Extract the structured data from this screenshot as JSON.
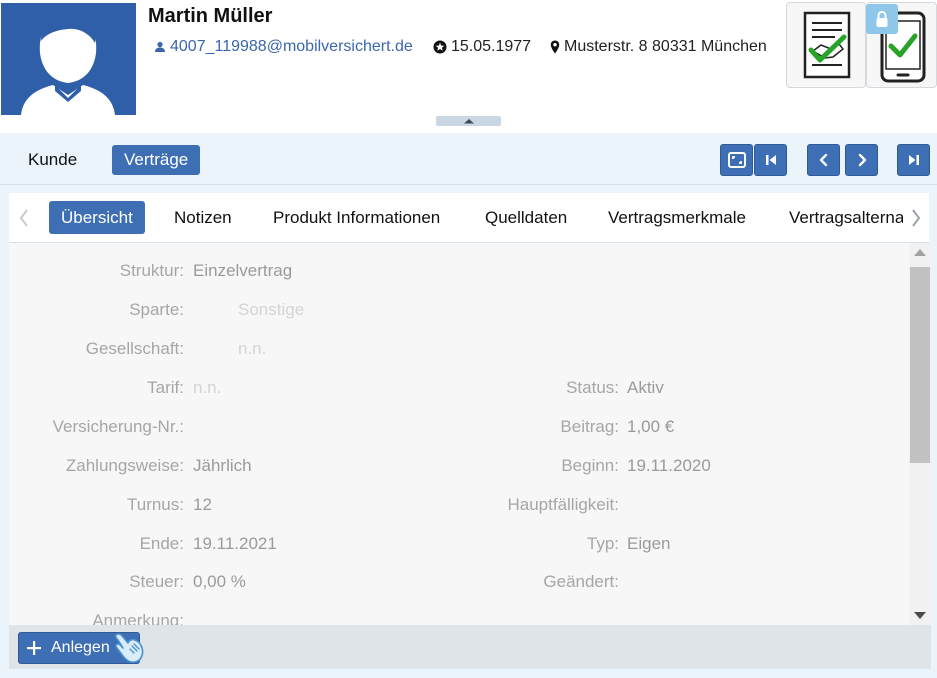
{
  "customer": {
    "name": "Martin Müller",
    "email": "4007_119988@mobilversichert.de",
    "birthdate": "15.05.1977",
    "address": "Musterstr. 8 80331 München"
  },
  "toolbar": {
    "tab_kunde": "Kunde",
    "tab_vertraege": "Verträge"
  },
  "subtabs": [
    {
      "label": "Übersicht",
      "active": true
    },
    {
      "label": "Notizen",
      "active": false
    },
    {
      "label": "Produkt Informationen",
      "active": false
    },
    {
      "label": "Quelldaten",
      "active": false
    },
    {
      "label": "Vertragsmerkmale",
      "active": false
    },
    {
      "label": "Vertragsalterna",
      "active": false
    }
  ],
  "details": {
    "struktur_label": "Struktur:",
    "struktur_value": "Einzelvertrag",
    "sparte_label": "Sparte:",
    "sparte_value": "Sonstige",
    "gesellschaft_label": "Gesellschaft:",
    "gesellschaft_value": "n.n.",
    "tarif_label": "Tarif:",
    "tarif_value": "n.n.",
    "status_label": "Status:",
    "status_value": "Aktiv",
    "versicherung_label": "Versicherung-Nr.:",
    "versicherung_value": "",
    "beitrag_label": "Beitrag:",
    "beitrag_value": "1,00 €",
    "zahlungsweise_label": "Zahlungsweise:",
    "zahlungsweise_value": "Jährlich",
    "beginn_label": "Beginn:",
    "beginn_value": "19.11.2020",
    "turnus_label": "Turnus:",
    "turnus_value": "12",
    "hauptfaelligkeit_label": "Hauptfälligkeit:",
    "hauptfaelligkeit_value": "",
    "ende_label": "Ende:",
    "ende_value": "19.11.2021",
    "typ_label": "Typ:",
    "typ_value": "Eigen",
    "steuer_label": "Steuer:",
    "steuer_value": "0,00 %",
    "geaendert_label": "Geändert:",
    "geaendert_value": "",
    "anmerkung_label": "Anmerkung:"
  },
  "footer": {
    "add_label": "Anlegen"
  },
  "colors": {
    "primary": "#3e6fb5",
    "avatar_bg": "#2f5fa8",
    "panel_bg": "#eaf4fa",
    "check_green": "#27a427"
  }
}
